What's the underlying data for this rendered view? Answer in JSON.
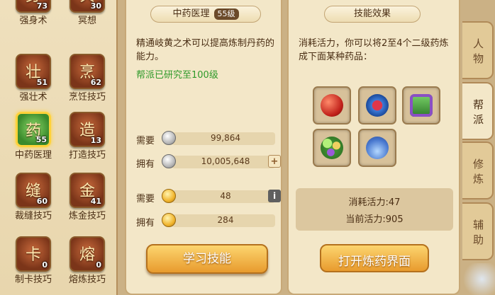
{
  "skills": [
    {
      "name": "强身术",
      "level": "73",
      "glyph": "身",
      "selected": false
    },
    {
      "name": "冥想",
      "level": "30",
      "glyph": "冥",
      "selected": false
    },
    {
      "name": "强壮术",
      "level": "51",
      "glyph": "壮",
      "selected": false
    },
    {
      "name": "烹饪技巧",
      "level": "62",
      "glyph": "烹",
      "selected": false
    },
    {
      "name": "中药医理",
      "level": "55",
      "glyph": "药",
      "selected": true
    },
    {
      "name": "打造技巧",
      "level": "13",
      "glyph": "造",
      "selected": false
    },
    {
      "name": "裁缝技巧",
      "level": "60",
      "glyph": "缝",
      "selected": false
    },
    {
      "name": "炼金技巧",
      "level": "41",
      "glyph": "金",
      "selected": false
    },
    {
      "name": "制卡技巧",
      "level": "0",
      "glyph": "卡",
      "selected": false
    },
    {
      "name": "熔炼技巧",
      "level": "0",
      "glyph": "熔",
      "selected": false
    }
  ],
  "detail": {
    "title": "中药医理",
    "level_badge": "55级",
    "description": "精通岐黄之术可以提高炼制丹药的能力。",
    "research_note": "帮派已研究至100级",
    "cost_label": "需要",
    "cost_value": "99,864",
    "own_label": "拥有",
    "own_value": "10,005,648",
    "plus_label": "+",
    "need2_label": "需要",
    "need2_value": "48",
    "info_label": "i",
    "own2_label": "拥有",
    "own2_value": "284",
    "learn_button": "学习技能"
  },
  "effect": {
    "title": "技能效果",
    "description": "消耗活力，你可以将2至4个二级药炼成下面某种药品：",
    "medicine_icons": [
      "red-pill-pouch-icon",
      "blue-bowl-icon",
      "green-chest-icon",
      "green-beads-icon",
      "blue-potion-bottle-icon"
    ],
    "stamina_cost": "消耗活力:47",
    "stamina_current": "当前活力:905",
    "open_button": "打开炼药界面"
  },
  "tabs": [
    {
      "label": "人物",
      "active": false
    },
    {
      "label": "帮派",
      "active": true
    },
    {
      "label": "修炼",
      "active": false
    },
    {
      "label": "辅助",
      "active": false
    }
  ]
}
